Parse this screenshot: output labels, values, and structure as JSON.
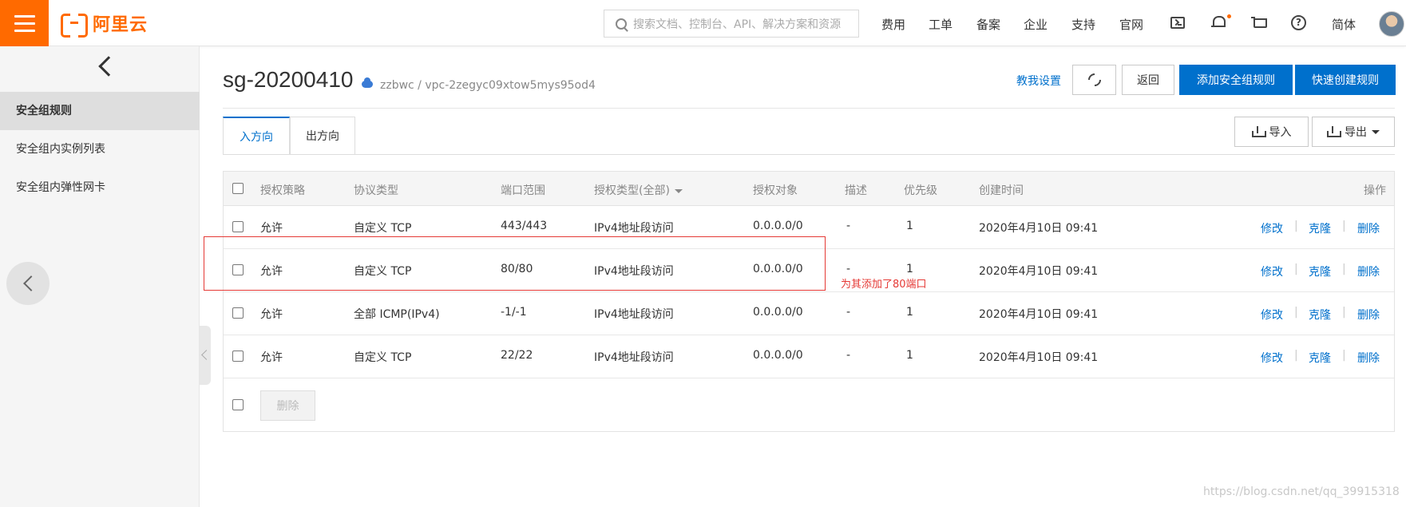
{
  "brand": {
    "name": "阿里云",
    "accent": "#ff6a00"
  },
  "search": {
    "placeholder": "搜索文档、控制台、API、解决方案和资源"
  },
  "topnav": [
    "费用",
    "工单",
    "备案",
    "企业",
    "支持",
    "官网"
  ],
  "lang": "简体",
  "icons": {
    "menu": "hamburger-icon",
    "terminal": "terminal-icon",
    "bell": "bell-icon",
    "cart": "cart-icon",
    "help": "help-icon"
  },
  "sidebar": {
    "items": [
      {
        "label": "安全组规则",
        "active": true
      },
      {
        "label": "安全组内实例列表",
        "active": false
      },
      {
        "label": "安全组内弹性网卡",
        "active": false
      }
    ]
  },
  "page": {
    "title": "sg-20200410",
    "subtitle": "zzbwc / vpc-2zegyc09xtow5mys95od4",
    "teach_link": "教我设置",
    "back_label": "返回",
    "add_rule_label": "添加安全组规则",
    "quick_create_label": "快速创建规则",
    "import_label": "导入",
    "export_label": "导出"
  },
  "tabs": [
    {
      "label": "入方向",
      "active": true
    },
    {
      "label": "出方向",
      "active": false
    }
  ],
  "table": {
    "headers": [
      "授权策略",
      "协议类型",
      "端口范围",
      "授权类型(全部)",
      "授权对象",
      "描述",
      "优先级",
      "创建时间",
      "操作"
    ],
    "rows": [
      {
        "policy": "允许",
        "protocol": "自定义 TCP",
        "port": "443/443",
        "auth_type": "IPv4地址段访问",
        "target": "0.0.0.0/0",
        "desc": "-",
        "priority": "1",
        "created": "2020年4月10日 09:41"
      },
      {
        "policy": "允许",
        "protocol": "自定义 TCP",
        "port": "80/80",
        "auth_type": "IPv4地址段访问",
        "target": "0.0.0.0/0",
        "desc": "-",
        "priority": "1",
        "created": "2020年4月10日 09:41"
      },
      {
        "policy": "允许",
        "protocol": "全部 ICMP(IPv4)",
        "port": "-1/-1",
        "auth_type": "IPv4地址段访问",
        "target": "0.0.0.0/0",
        "desc": "-",
        "priority": "1",
        "created": "2020年4月10日 09:41"
      },
      {
        "policy": "允许",
        "protocol": "自定义 TCP",
        "port": "22/22",
        "auth_type": "IPv4地址段访问",
        "target": "0.0.0.0/0",
        "desc": "-",
        "priority": "1",
        "created": "2020年4月10日 09:41"
      }
    ],
    "actions": [
      "修改",
      "克隆",
      "删除"
    ],
    "action_sep": "|",
    "bulk_delete_label": "删除"
  },
  "annotation": {
    "text": "为其添加了80端口",
    "color": "#e53935"
  },
  "watermark": "https://blog.csdn.net/qq_39915318"
}
